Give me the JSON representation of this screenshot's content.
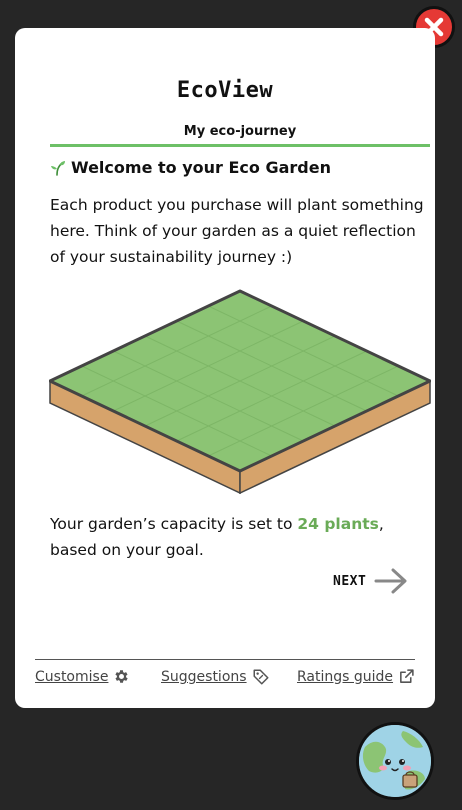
{
  "brand": {
    "name": "EcoView"
  },
  "journey": {
    "label": "My eco-journey"
  },
  "welcome": {
    "title": "Welcome to your Eco Garden",
    "intro": "Each product you purchase will plant something here. Think of your garden as a quiet reflection of your sustainability journey :)"
  },
  "capacity": {
    "prefix": " Your garden’s capacity is set to ",
    "plants": "24 plants",
    "suffix": ", based on your goal."
  },
  "navigation": {
    "next_label": "NEXT"
  },
  "footer": {
    "customise": "Customise",
    "suggestions": "Suggestions",
    "ratings": "Ratings guide"
  },
  "colors": {
    "accent_green": "#6dc067",
    "plants_green": "#6aab57",
    "close_red": "#e53935",
    "grass": "#8cc474",
    "soil": "#d6a36b",
    "background": "#262626"
  },
  "icons": {
    "close": "close-icon",
    "sprout": "sprout-icon",
    "next": "arrow-right-icon",
    "customise": "gear-icon",
    "suggestions": "tag-icon",
    "ratings": "external-link-icon",
    "avatar": "earth-mascot-icon"
  }
}
